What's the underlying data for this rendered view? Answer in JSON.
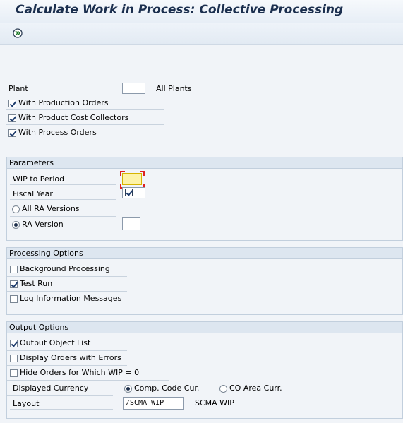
{
  "title": "Calculate Work in Process: Collective Processing",
  "toolbar": {
    "execute_icon": "execute-icon"
  },
  "selection": {
    "plant_label": "Plant",
    "plant_value": "",
    "plant_desc": "All Plants",
    "production_orders_label": "With Production Orders",
    "production_orders_checked": true,
    "product_cost_collectors_label": "With Product Cost Collectors",
    "product_cost_collectors_checked": true,
    "process_orders_label": "With Process Orders",
    "process_orders_checked": true
  },
  "parameters": {
    "header": "Parameters",
    "wip_to_period_label": "WIP to Period",
    "wip_to_period_value": "",
    "fiscal_year_label": "Fiscal Year",
    "fiscal_year_checked": true,
    "all_ra_versions_label": "All RA Versions",
    "ra_version_label": "RA Version",
    "ra_version_value": "",
    "selected_radio": "ra_version"
  },
  "processing": {
    "header": "Processing Options",
    "background_label": "Background Processing",
    "background_checked": false,
    "test_run_label": "Test Run",
    "test_run_checked": true,
    "log_info_label": "Log Information Messages",
    "log_info_checked": false
  },
  "output": {
    "header": "Output Options",
    "object_list_label": "Output Object List",
    "object_list_checked": true,
    "display_errors_label": "Display Orders with Errors",
    "display_errors_checked": false,
    "hide_orders_label": "Hide Orders for Which WIP = 0",
    "hide_orders_checked": false,
    "currency_label": "Displayed Currency",
    "comp_code_label": "Comp. Code Cur.",
    "co_area_label": "CO Area Curr.",
    "selected_currency": "comp_code",
    "layout_label": "Layout",
    "layout_value": "/SCMA WIP",
    "layout_desc": "SCMA WIP"
  },
  "colors": {
    "title": "#1b2f4e",
    "required_field": "#fdf3a8",
    "group_header": "#dde6f0"
  }
}
